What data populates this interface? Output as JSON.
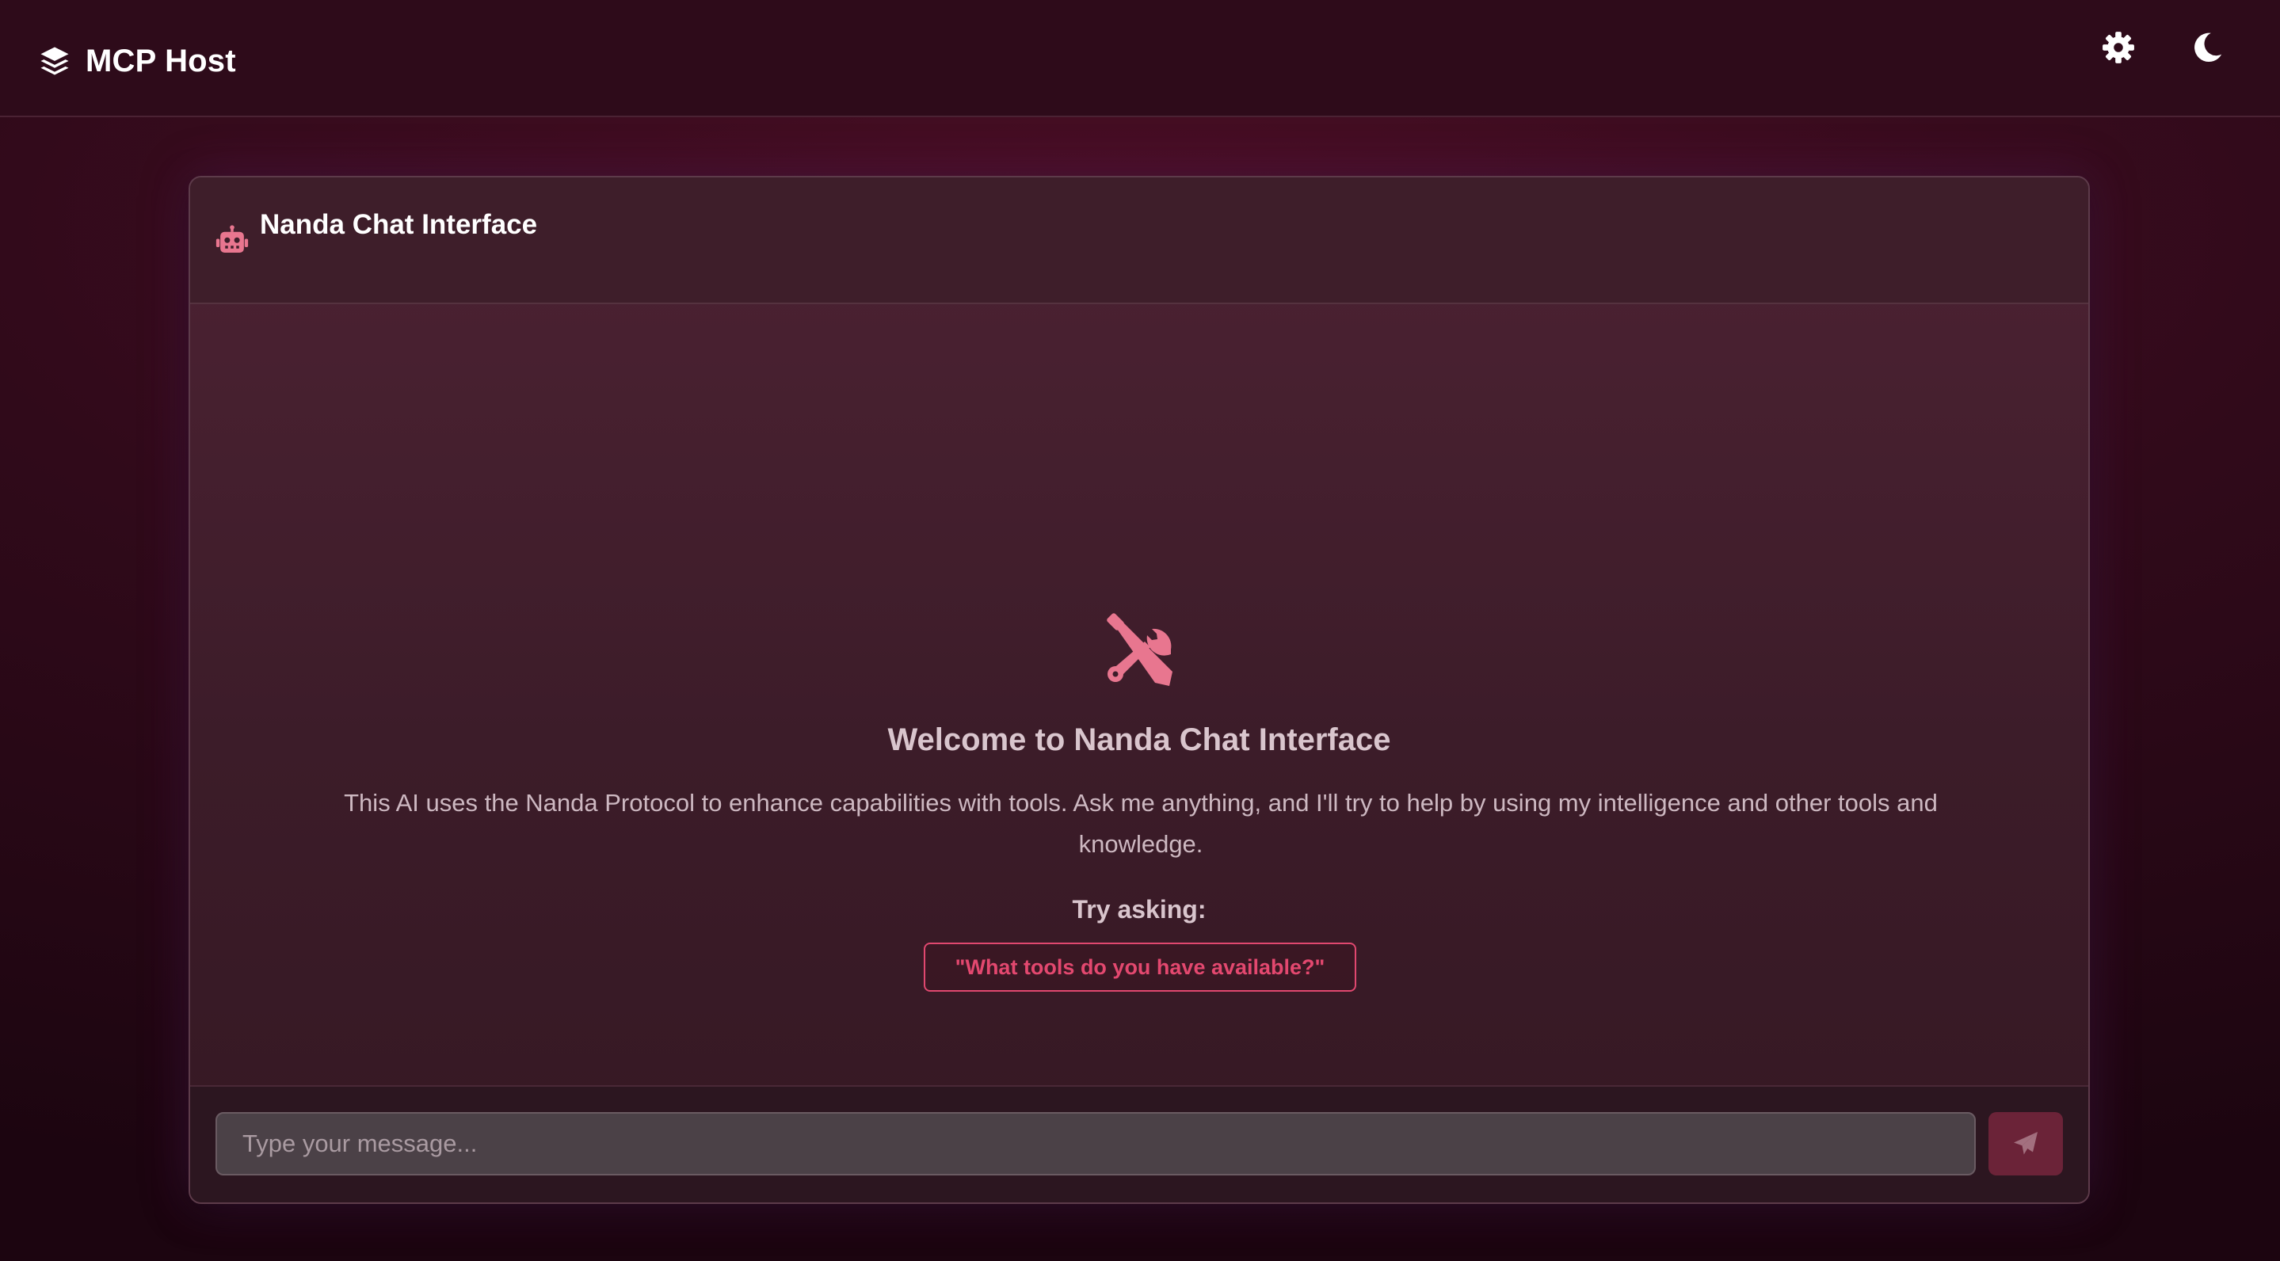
{
  "header": {
    "title": "MCP Host",
    "logo_icon": "layers-icon",
    "actions": [
      {
        "name": "settings",
        "icon": "gear-icon"
      },
      {
        "name": "theme-toggle",
        "icon": "moon-icon"
      }
    ]
  },
  "chat": {
    "title": "Nanda Chat Interface",
    "title_icon": "robot-icon",
    "welcome": {
      "icon": "tools-icon",
      "title": "Welcome to Nanda Chat Interface",
      "description": "This AI uses the Nanda Protocol to enhance capabilities with tools. Ask me anything, and I'll try to help by using my intelligence and other tools and knowledge.",
      "try_label": "Try asking:",
      "suggestions": [
        "\"What tools do you have available?\""
      ]
    },
    "input": {
      "placeholder": "Type your message...",
      "value": ""
    },
    "send_icon": "paper-plane-icon"
  },
  "colors": {
    "accent": "#e0486f",
    "background": "#300a1a",
    "card": "#3c1c29",
    "send_button": "#6b2338"
  }
}
